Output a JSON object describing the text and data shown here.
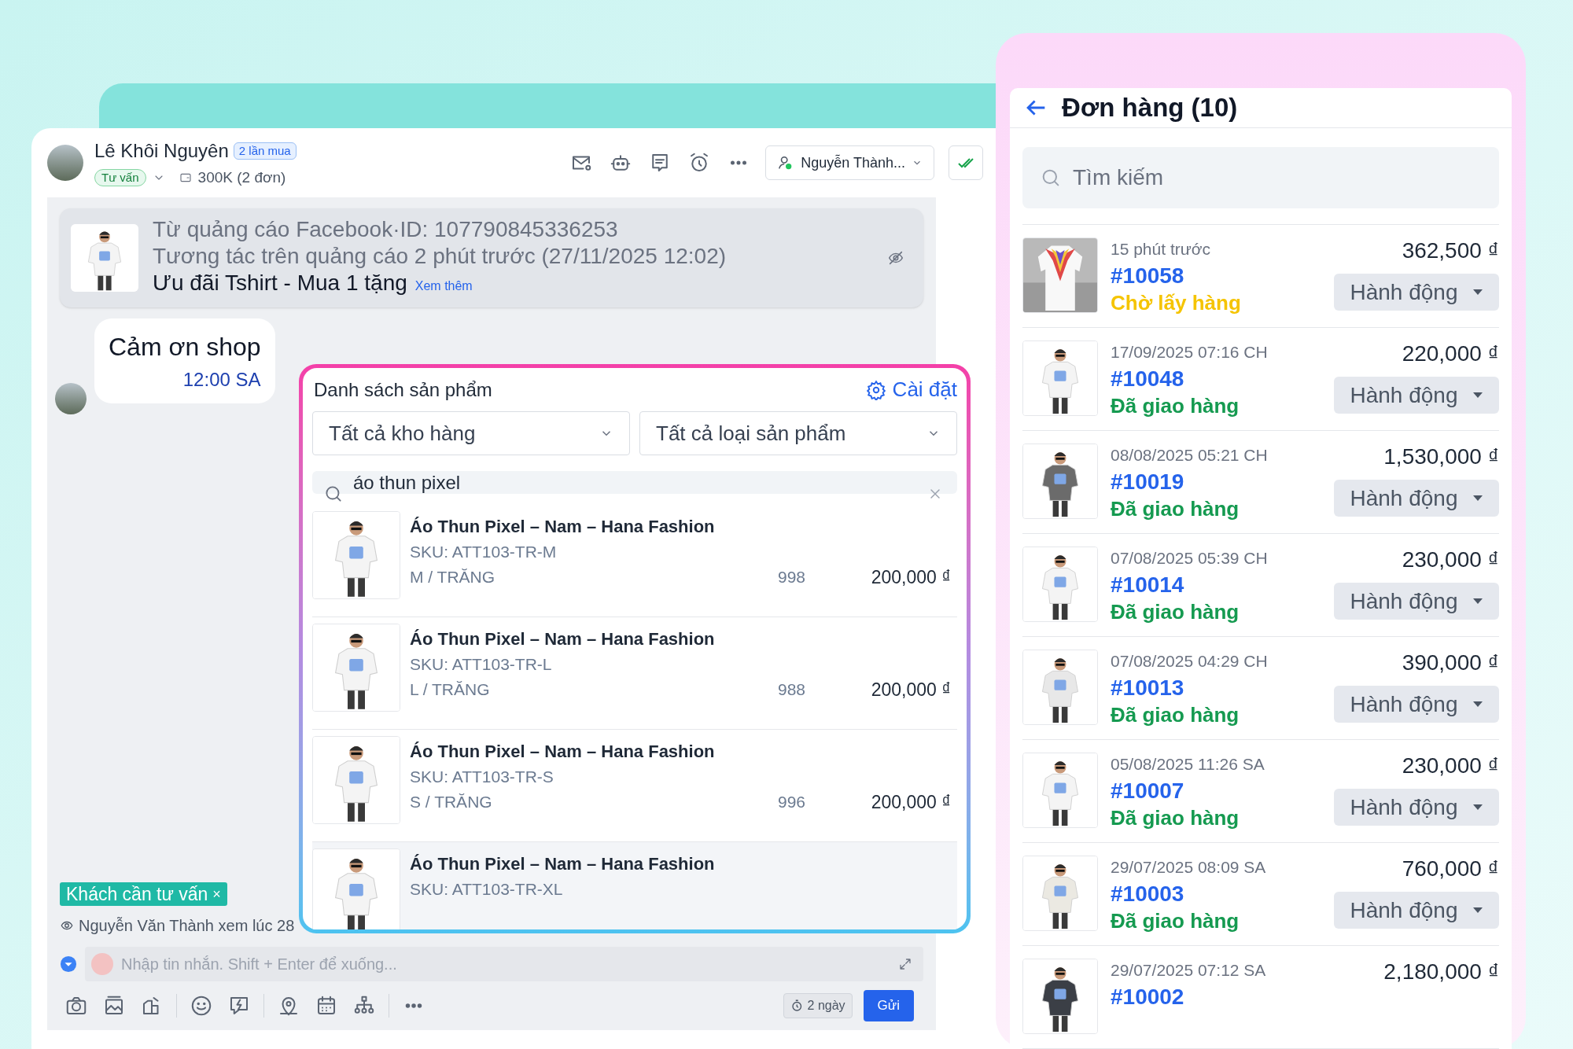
{
  "chat": {
    "customer": {
      "name": "Lê Khôi Nguyên",
      "badge": "2 lần mua",
      "status_tag": "Tư vấn",
      "spend": "300K (2 đơn)"
    },
    "assignee": "Nguyễn Thành...",
    "ad_card": {
      "source": "Từ quảng cáo Facebook·ID: 107790845336253",
      "interaction": "Tương tác trên quảng cáo 2 phút trước (27/11/2025 12:02)",
      "title": "Ưu đãi Tshirt - Mua 1 tặng",
      "more_link": "Xem thêm"
    },
    "messages": [
      {
        "text": "Cảm ơn shop",
        "time": "12:00 SA"
      }
    ],
    "tags": [
      {
        "label": "Khách cần tư vấn",
        "remove": "×"
      }
    ],
    "seen_note": "Nguyễn Văn Thành xem lúc 28",
    "composer": {
      "placeholder": "Nhập tin nhắn. Shift + Enter để xuống...",
      "reminder": "2 ngày",
      "send": "Gửi"
    }
  },
  "product_picker": {
    "title": "Danh sách sản phẩm",
    "settings": "Cài đặt",
    "filters": [
      "Tất cả kho hàng",
      "Tất cả loại sản phẩm"
    ],
    "search": {
      "value": "áo thun pixel"
    },
    "products": [
      {
        "name": "Áo Thun Pixel – Nam – Hana Fashion",
        "sku": "SKU: ATT103-TR-M",
        "variant": "M / TRĂNG",
        "stock": "998",
        "price": "200,000 ₫",
        "hovered": false
      },
      {
        "name": "Áo Thun Pixel – Nam – Hana Fashion",
        "sku": "SKU: ATT103-TR-L",
        "variant": "L / TRĂNG",
        "stock": "988",
        "price": "200,000 ₫",
        "hovered": false
      },
      {
        "name": "Áo Thun Pixel – Nam – Hana Fashion",
        "sku": "SKU: ATT103-TR-S",
        "variant": "S / TRĂNG",
        "stock": "996",
        "price": "200,000 ₫",
        "hovered": false
      },
      {
        "name": "Áo Thun Pixel – Nam – Hana Fashion",
        "sku": "SKU: ATT103-TR-XL",
        "hovered": true
      }
    ]
  },
  "orders": {
    "title": "Đơn hàng (10)",
    "search": {
      "placeholder": "Tìm kiếm"
    },
    "items": [
      {
        "time": "15 phút trước",
        "id": "#10058",
        "status": "Chờ lấy hàng",
        "kind": "pending",
        "amount": "362,500 ₫",
        "action": "Hành động"
      },
      {
        "time": "17/09/2025 07:16 CH",
        "id": "#10048",
        "status": "Đã giao hàng",
        "kind": "delivered",
        "amount": "220,000 ₫",
        "action": "Hành động"
      },
      {
        "time": "08/08/2025 05:21 CH",
        "id": "#10019",
        "status": "Đã giao hàng",
        "kind": "delivered",
        "amount": "1,530,000 ₫",
        "action": "Hành động"
      },
      {
        "time": "07/08/2025 05:39 CH",
        "id": "#10014",
        "status": "Đã giao hàng",
        "kind": "delivered",
        "amount": "230,000 ₫",
        "action": "Hành động"
      },
      {
        "time": "07/08/2025 04:29 CH",
        "id": "#10013",
        "status": "Đã giao hàng",
        "kind": "delivered",
        "amount": "390,000 ₫",
        "action": "Hành động"
      },
      {
        "time": "05/08/2025 11:26 SA",
        "id": "#10007",
        "status": "Đã giao hàng",
        "kind": "delivered",
        "amount": "230,000 ₫",
        "action": "Hành động"
      },
      {
        "time": "29/07/2025 08:09 SA",
        "id": "#10003",
        "status": "Đã giao hàng",
        "kind": "delivered",
        "amount": "760,000 ₫",
        "action": "Hành động"
      },
      {
        "time": "29/07/2025 07:12 SA",
        "id": "#10002",
        "amount": "2,180,000 ₫"
      }
    ]
  }
}
